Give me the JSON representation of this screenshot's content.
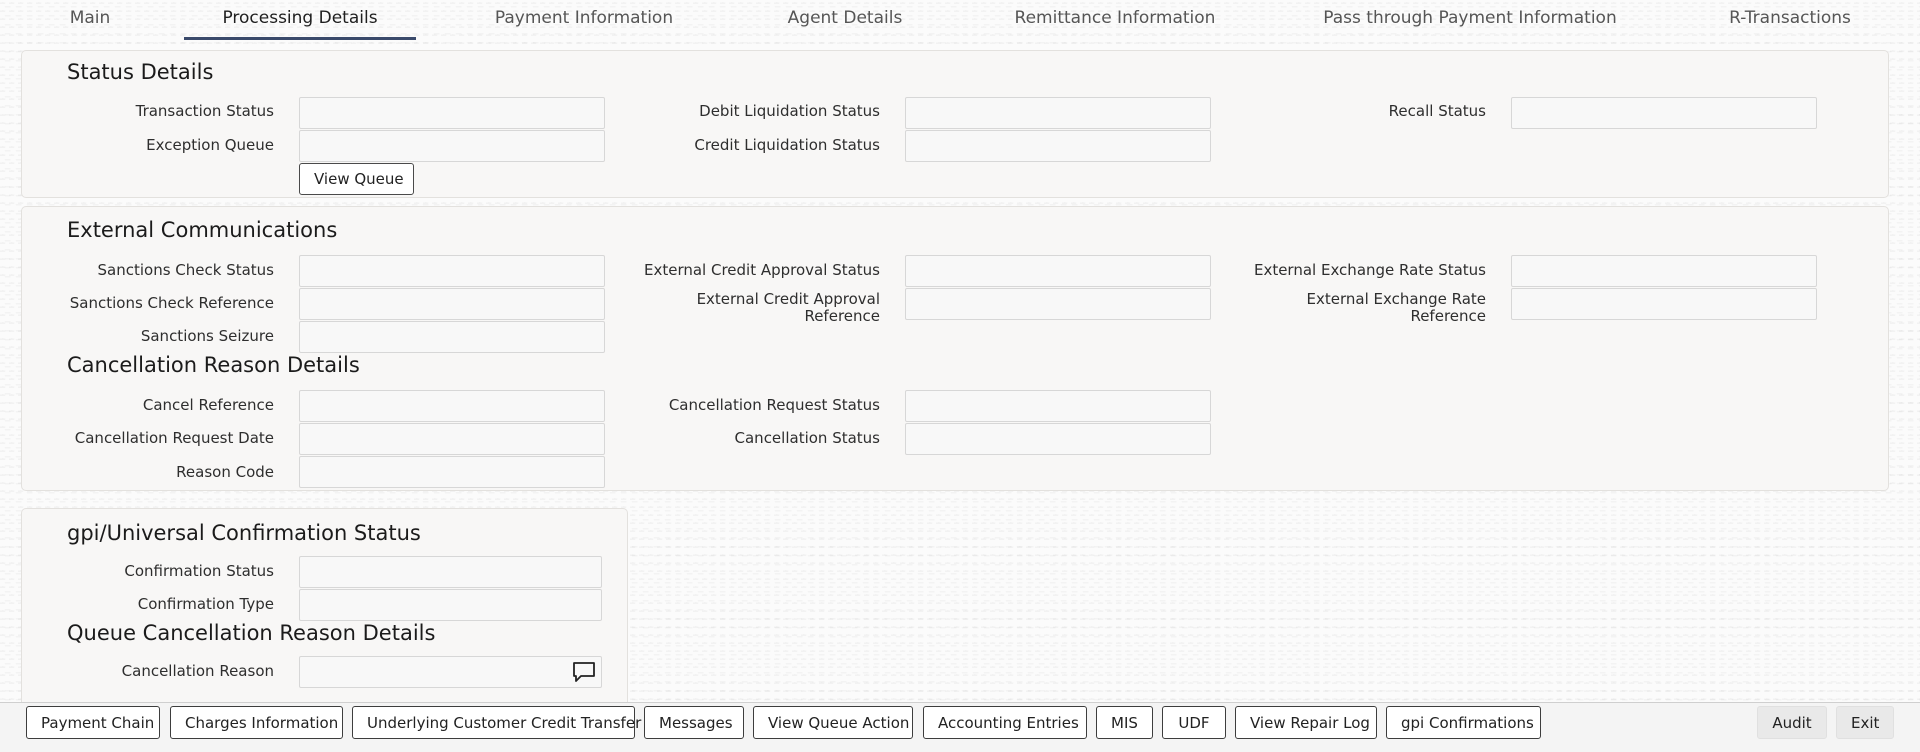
{
  "tabs": [
    {
      "label": "Main",
      "active": false
    },
    {
      "label": "Processing Details",
      "active": true
    },
    {
      "label": "Payment Information",
      "active": false
    },
    {
      "label": "Agent Details",
      "active": false
    },
    {
      "label": "Remittance Information",
      "active": false
    },
    {
      "label": "Pass through Payment Information",
      "active": false
    },
    {
      "label": "R-Transactions",
      "active": false
    }
  ],
  "status_details": {
    "title": "Status Details",
    "transaction_status": {
      "label": "Transaction Status",
      "value": ""
    },
    "exception_queue": {
      "label": "Exception Queue",
      "value": ""
    },
    "view_queue_button": "View Queue",
    "debit_liquidation_status": {
      "label": "Debit Liquidation Status",
      "value": ""
    },
    "credit_liquidation_status": {
      "label": "Credit Liquidation Status",
      "value": ""
    },
    "recall_status": {
      "label": "Recall Status",
      "value": ""
    }
  },
  "external_communications": {
    "title": "External Communications",
    "sanctions_check_status": {
      "label": "Sanctions Check Status",
      "value": ""
    },
    "sanctions_check_reference": {
      "label": "Sanctions Check Reference",
      "value": ""
    },
    "sanctions_seizure": {
      "label": "Sanctions Seizure",
      "value": ""
    },
    "external_credit_approval_status": {
      "label": "External Credit Approval Status",
      "value": ""
    },
    "external_credit_approval_reference": {
      "label": "External Credit Approval Reference",
      "value": ""
    },
    "external_exchange_rate_status": {
      "label": "External Exchange Rate Status",
      "value": ""
    },
    "external_exchange_rate_reference": {
      "label": "External Exchange Rate Reference",
      "value": ""
    }
  },
  "cancellation_reason_details": {
    "title": "Cancellation Reason Details",
    "cancel_reference": {
      "label": "Cancel Reference",
      "value": ""
    },
    "cancellation_request_date": {
      "label": "Cancellation Request Date",
      "value": ""
    },
    "reason_code": {
      "label": "Reason Code",
      "value": ""
    },
    "cancellation_request_status": {
      "label": "Cancellation Request Status",
      "value": ""
    },
    "cancellation_status": {
      "label": "Cancellation Status",
      "value": ""
    }
  },
  "gpi_confirmation_status": {
    "title": "gpi/Universal Confirmation Status",
    "confirmation_status": {
      "label": "Confirmation Status",
      "value": ""
    },
    "confirmation_type": {
      "label": "Confirmation Type",
      "value": ""
    }
  },
  "queue_cancellation": {
    "title": "Queue Cancellation Reason Details",
    "cancellation_reason": {
      "label": "Cancellation Reason",
      "value": ""
    }
  },
  "footer": {
    "buttons": [
      "Payment Chain",
      "Charges Information",
      "Underlying Customer Credit Transfer",
      "Messages",
      "View Queue Action",
      "Accounting Entries",
      "MIS",
      "UDF",
      "View Repair Log",
      "gpi Confirmations"
    ],
    "audit": "Audit",
    "exit": "Exit"
  },
  "icons": {
    "cancellation_reason_lookup": "message-icon"
  }
}
